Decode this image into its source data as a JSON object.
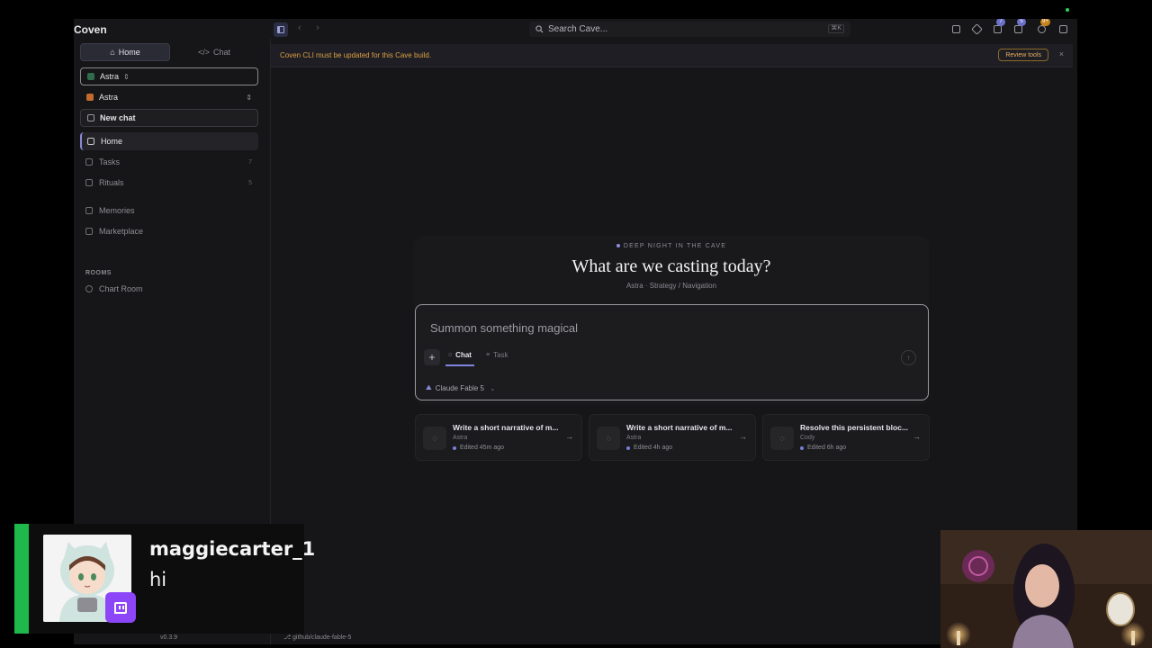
{
  "app": {
    "name": "Coven",
    "version": "v0.3.9",
    "branch": "github/claude-fable-5"
  },
  "topbar": {
    "search_placeholder": "Search Cave...",
    "search_shortcut": "⌘K",
    "icons": [
      "compose-icon",
      "bot-icon",
      "agents-icon",
      "inbox-icon",
      "notifications-icon",
      "panel-icon"
    ],
    "badges": {
      "agents": "7",
      "inbox": "5",
      "notifications": "9+"
    }
  },
  "sidebar": {
    "mode_tabs": [
      {
        "label": "Home",
        "icon": "home-icon",
        "active": true
      },
      {
        "label": "Chat",
        "icon": "code-icon",
        "active": false
      }
    ],
    "workspace": "Astra",
    "agent": "Astra",
    "new_chat": "New chat",
    "nav": [
      {
        "label": "Home",
        "icon": "home-icon",
        "active": true,
        "count": ""
      },
      {
        "label": "Tasks",
        "icon": "tasks-icon",
        "active": false,
        "count": "7"
      },
      {
        "label": "Rituals",
        "icon": "rituals-icon",
        "active": false,
        "count": "5"
      },
      {
        "label": "Memories",
        "icon": "memories-icon",
        "active": false,
        "count": ""
      },
      {
        "label": "Marketplace",
        "icon": "marketplace-icon",
        "active": false,
        "count": ""
      }
    ],
    "rooms_label": "ROOMS",
    "rooms": [
      {
        "label": "Chart Room",
        "icon": "compass-icon"
      }
    ]
  },
  "banner": {
    "text": "Coven CLI must be updated for this Cave build.",
    "button": "Review tools",
    "accent": "#d9a144"
  },
  "hero": {
    "eyebrow": "DEEP NIGHT IN THE CAVE",
    "title": "What are we casting today?",
    "subtitle": "Astra · Strategy / Navigation"
  },
  "composer": {
    "placeholder": "Summon something magical",
    "tabs": [
      {
        "label": "Chat",
        "active": true
      },
      {
        "label": "Task",
        "active": false
      }
    ],
    "model": "Claude Fable 5",
    "accent": "#7f84e0"
  },
  "recents": [
    {
      "title": "Write a short narrative of m...",
      "owner": "Astra",
      "time": "Edited 45m ago"
    },
    {
      "title": "Write a short narrative of m...",
      "owner": "Astra",
      "time": "Edited 4h ago"
    },
    {
      "title": "Resolve this persistent bloc...",
      "owner": "Cody",
      "time": "Edited 6h ago"
    }
  ],
  "stream_overlay": {
    "username": "maggiecarter_1",
    "message": "hi",
    "bar_color": "#1fb84a",
    "platform_icon": "twitch-icon"
  }
}
